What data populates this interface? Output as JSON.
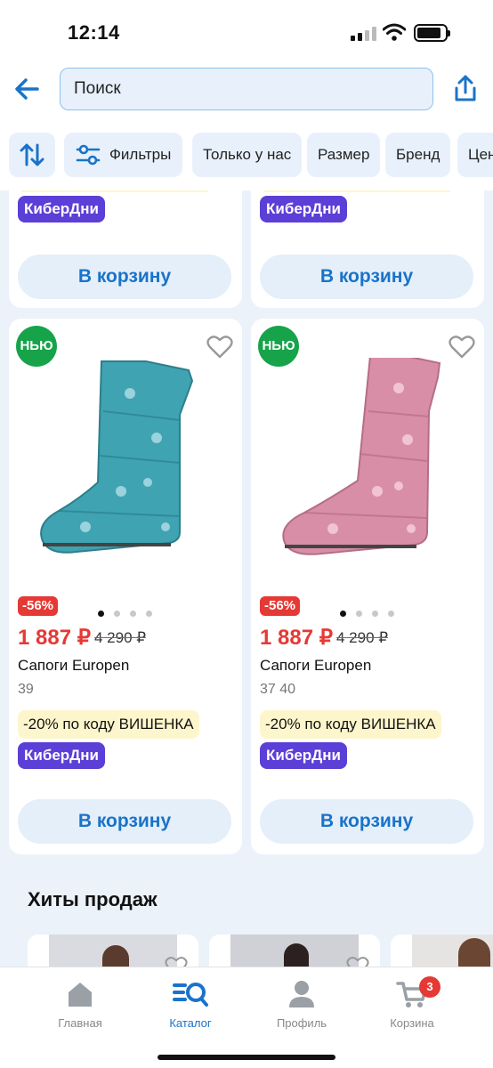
{
  "status": {
    "time": "12:14"
  },
  "search": {
    "placeholder": "Поиск"
  },
  "filters": [
    "Фильтры",
    "Только у нас",
    "Размер",
    "Бренд",
    "Цена"
  ],
  "top_cards": [
    {
      "badge": "КиберДни",
      "button": "В корзину"
    },
    {
      "badge": "КиберДни",
      "button": "В корзину"
    }
  ],
  "products": [
    {
      "new_badge": "НЬЮ",
      "discount": "-56%",
      "price": "1 887 ₽",
      "old_price": "4 290 ₽",
      "name": "Сапоги Europen",
      "sizes": "39",
      "promo": "-20% по коду ВИШЕНКА",
      "badge": "КиберДни",
      "button": "В корзину",
      "color": "#3fa3b2"
    },
    {
      "new_badge": "НЬЮ",
      "discount": "-56%",
      "price": "1 887 ₽",
      "old_price": "4 290 ₽",
      "name": "Сапоги Europen",
      "sizes": "37  40",
      "promo": "-20% по коду ВИШЕНКА",
      "badge": "КиберДни",
      "button": "В корзину",
      "color": "#d98ea8"
    }
  ],
  "section": {
    "title": "Хиты продаж"
  },
  "tabs": [
    {
      "label": "Главная",
      "icon": "home-icon"
    },
    {
      "label": "Каталог",
      "icon": "catalog-search-icon",
      "active": true
    },
    {
      "label": "Профиль",
      "icon": "profile-icon"
    },
    {
      "label": "Корзина",
      "icon": "cart-icon",
      "count": "3"
    }
  ],
  "colors": {
    "accent": "#1a73c9",
    "sale": "#e53935",
    "cyber": "#5b3fd6",
    "new": "#16a34a"
  }
}
